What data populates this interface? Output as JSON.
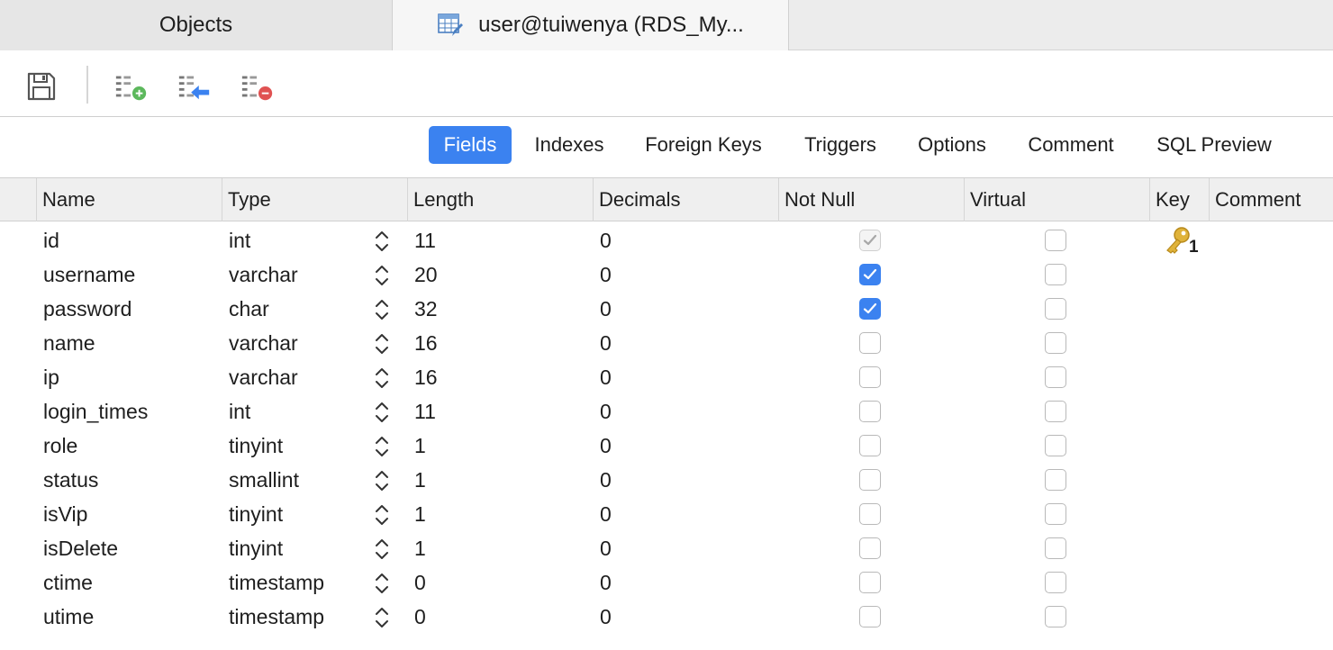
{
  "tabs": [
    {
      "label": "Objects",
      "active": false
    },
    {
      "label": "user@tuiwenya (RDS_My...",
      "active": true,
      "icon": "table-edit-icon"
    }
  ],
  "toolbar": {
    "buttons": [
      {
        "name": "save-icon"
      },
      {
        "name": "add-field-icon"
      },
      {
        "name": "insert-field-icon"
      },
      {
        "name": "delete-field-icon"
      }
    ]
  },
  "subtabs": [
    "Fields",
    "Indexes",
    "Foreign Keys",
    "Triggers",
    "Options",
    "Comment",
    "SQL Preview"
  ],
  "active_subtab": "Fields",
  "columns": [
    "Name",
    "Type",
    "Length",
    "Decimals",
    "Not Null",
    "Virtual",
    "Key",
    "Comment"
  ],
  "rows": [
    {
      "name": "id",
      "type": "int",
      "length": "11",
      "decimals": "0",
      "not_null": "disabled-checked",
      "virtual": false,
      "key": "1"
    },
    {
      "name": "username",
      "type": "varchar",
      "length": "20",
      "decimals": "0",
      "not_null": true,
      "virtual": false,
      "key": ""
    },
    {
      "name": "password",
      "type": "char",
      "length": "32",
      "decimals": "0",
      "not_null": true,
      "virtual": false,
      "key": ""
    },
    {
      "name": "name",
      "type": "varchar",
      "length": "16",
      "decimals": "0",
      "not_null": false,
      "virtual": false,
      "key": ""
    },
    {
      "name": "ip",
      "type": "varchar",
      "length": "16",
      "decimals": "0",
      "not_null": false,
      "virtual": false,
      "key": ""
    },
    {
      "name": "login_times",
      "type": "int",
      "length": "11",
      "decimals": "0",
      "not_null": false,
      "virtual": false,
      "key": ""
    },
    {
      "name": "role",
      "type": "tinyint",
      "length": "1",
      "decimals": "0",
      "not_null": false,
      "virtual": false,
      "key": ""
    },
    {
      "name": "status",
      "type": "smallint",
      "length": "1",
      "decimals": "0",
      "not_null": false,
      "virtual": false,
      "key": ""
    },
    {
      "name": "isVip",
      "type": "tinyint",
      "length": "1",
      "decimals": "0",
      "not_null": false,
      "virtual": false,
      "key": ""
    },
    {
      "name": "isDelete",
      "type": "tinyint",
      "length": "1",
      "decimals": "0",
      "not_null": false,
      "virtual": false,
      "key": ""
    },
    {
      "name": "ctime",
      "type": "timestamp",
      "length": "0",
      "decimals": "0",
      "not_null": false,
      "virtual": false,
      "key": ""
    },
    {
      "name": "utime",
      "type": "timestamp",
      "length": "0",
      "decimals": "0",
      "not_null": false,
      "virtual": false,
      "key": ""
    }
  ],
  "colors": {
    "accent": "#3b82f0",
    "key": "#e0b33a"
  }
}
